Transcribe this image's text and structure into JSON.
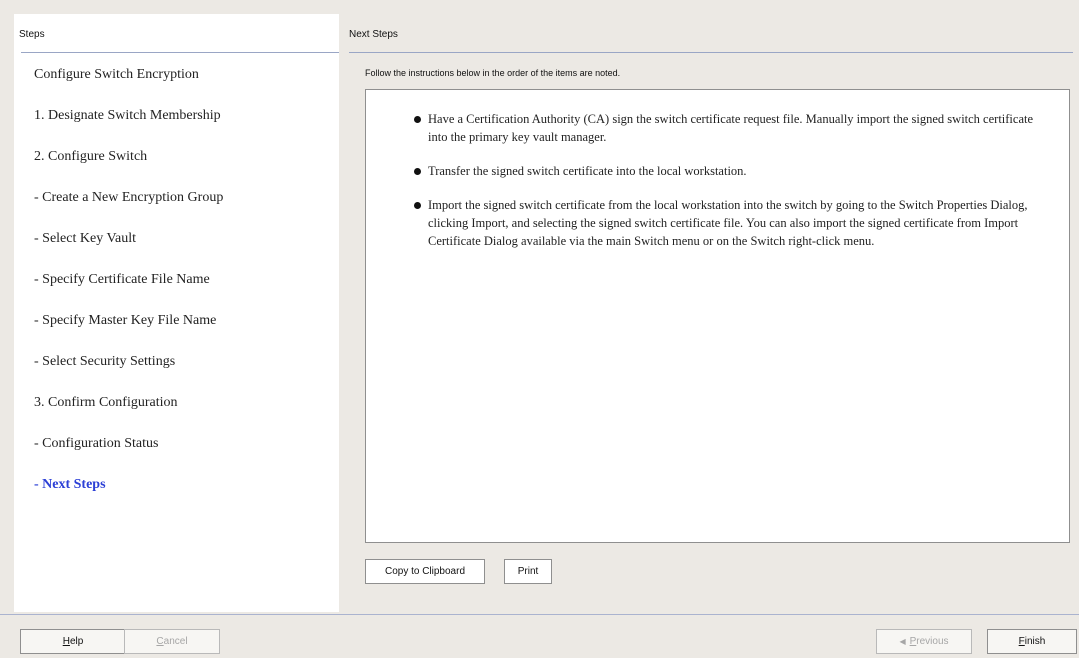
{
  "left_pane": {
    "header": "Steps",
    "steps": [
      {
        "label": "Configure Switch Encryption",
        "active": false
      },
      {
        "label": "1. Designate Switch Membership",
        "active": false
      },
      {
        "label": "2. Configure Switch",
        "active": false
      },
      {
        "label": "- Create a New Encryption Group",
        "active": false
      },
      {
        "label": "- Select Key Vault",
        "active": false
      },
      {
        "label": "- Specify Certificate File Name",
        "active": false
      },
      {
        "label": "- Specify Master Key File Name",
        "active": false
      },
      {
        "label": "- Select Security Settings",
        "active": false
      },
      {
        "label": "3. Confirm Configuration",
        "active": false
      },
      {
        "label": "- Configuration Status",
        "active": false
      },
      {
        "label": "- Next Steps",
        "active": true
      }
    ]
  },
  "right_pane": {
    "header": "Next Steps",
    "instructions": "Follow the instructions below in the order of the items are noted.",
    "bullets": [
      "Have a Certification Authority (CA) sign the switch certificate request file. Manually import the signed switch certificate into the primary key vault manager.",
      "Transfer the signed switch certificate into the local workstation.",
      "Import the signed switch certificate from the local workstation into the switch by going to the Switch Properties Dialog, clicking Import, and selecting the signed switch certificate file. You can also import the signed certificate from Import Certificate Dialog available via the main Switch menu or on the Switch right-click menu."
    ],
    "copy_button": "Copy to Clipboard",
    "print_button": "Print"
  },
  "footer": {
    "help_first": "H",
    "help_rest": "elp",
    "cancel_first": "C",
    "cancel_rest": "ancel",
    "previous_first": "P",
    "previous_rest": "revious",
    "finish_first": "F",
    "finish_rest": "inish"
  },
  "colors": {
    "active_step": "#2b3fd6",
    "background": "#ece9e4",
    "rule": "#9aa6c5"
  },
  "icons": {
    "previous_arrow": "left-arrow-icon",
    "bullet": "bullet-dot-icon"
  }
}
